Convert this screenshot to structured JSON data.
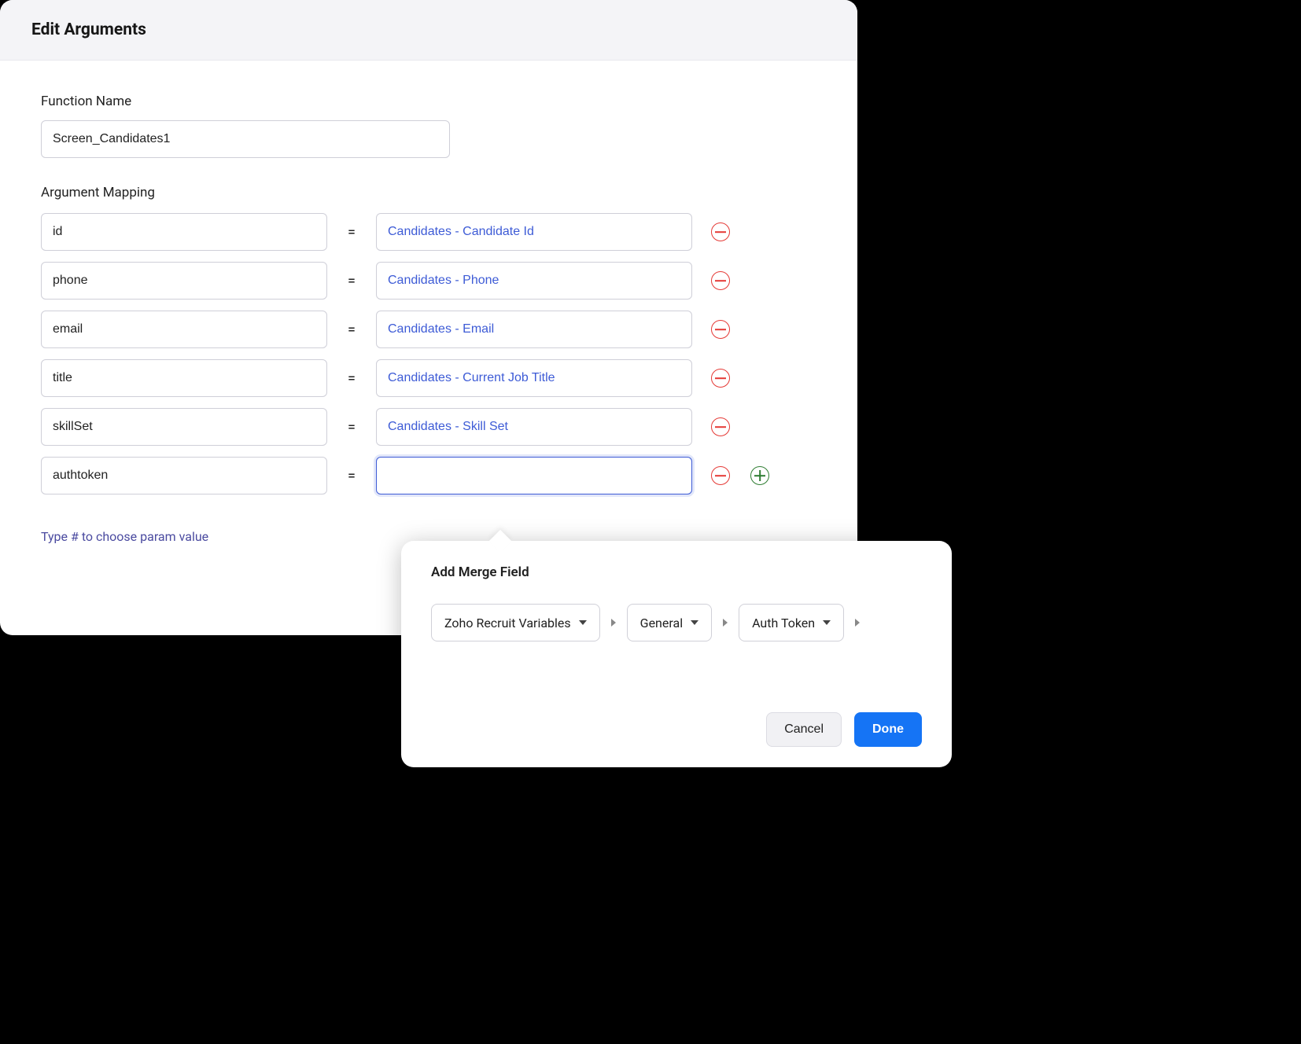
{
  "header": {
    "title": "Edit Arguments"
  },
  "form": {
    "function_name_label": "Function Name",
    "function_name_value": "Screen_Candidates1",
    "mapping_label": "Argument Mapping",
    "rows": [
      {
        "arg": "id",
        "val": "Candidates - Candidate Id"
      },
      {
        "arg": "phone",
        "val": "Candidates - Phone"
      },
      {
        "arg": "email",
        "val": "Candidates - Email"
      },
      {
        "arg": "title",
        "val": "Candidates - Current Job Title"
      },
      {
        "arg": "skillSet",
        "val": "Candidates - Skill Set"
      },
      {
        "arg": "authtoken",
        "val": ""
      }
    ],
    "eq": "=",
    "hint": "Type # to choose param value"
  },
  "popover": {
    "title": "Add Merge Field",
    "selects": [
      "Zoho Recruit Variables",
      "General",
      "Auth Token"
    ],
    "cancel": "Cancel",
    "done": "Done"
  }
}
